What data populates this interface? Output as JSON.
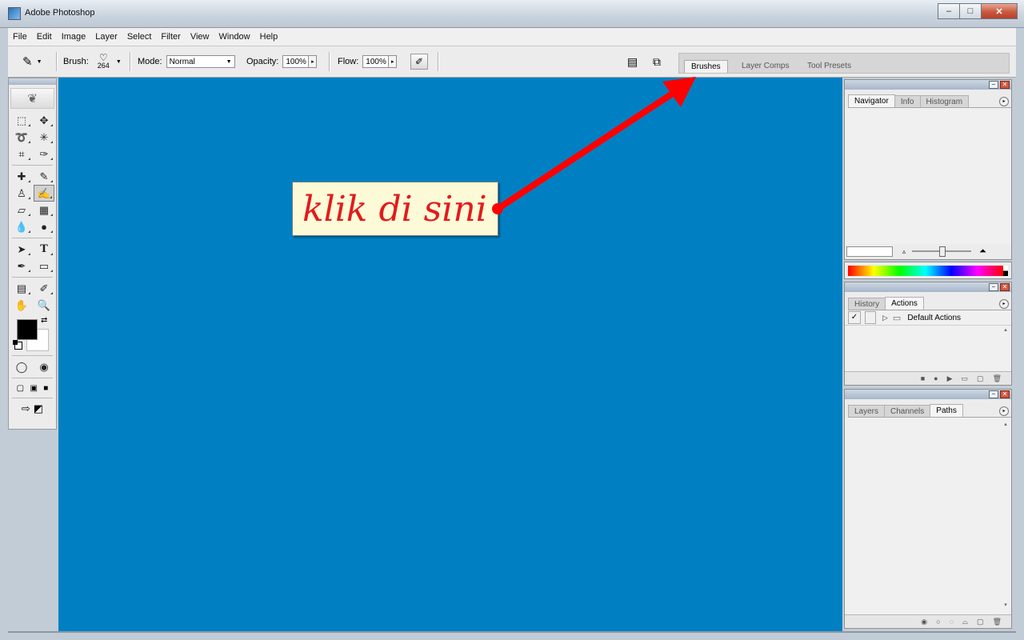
{
  "window": {
    "title": "Adobe Photoshop",
    "buttons": [
      "–",
      "□",
      "✕"
    ]
  },
  "menu": [
    "File",
    "Edit",
    "Image",
    "Layer",
    "Select",
    "Filter",
    "View",
    "Window",
    "Help"
  ],
  "options": {
    "brush_label": "Brush:",
    "brush_size": "264",
    "mode_label": "Mode:",
    "mode_value": "Normal",
    "opacity_label": "Opacity:",
    "opacity_value": "100%",
    "flow_label": "Flow:",
    "flow_value": "100%"
  },
  "well_tabs": [
    "Brushes",
    "Layer Comps",
    "Tool Presets"
  ],
  "callout": {
    "text": "klik di sini",
    "color": "#e21b1b"
  },
  "canvas_color": "#0080c2",
  "navigator": {
    "tabs": [
      "Navigator",
      "Info",
      "Histogram"
    ],
    "active": "Navigator"
  },
  "actions": {
    "tabs": [
      "History",
      "Actions"
    ],
    "active": "Actions",
    "items": [
      {
        "label": "Default Actions"
      }
    ]
  },
  "layers": {
    "tabs": [
      "Layers",
      "Channels",
      "Paths"
    ],
    "active": "Paths"
  }
}
